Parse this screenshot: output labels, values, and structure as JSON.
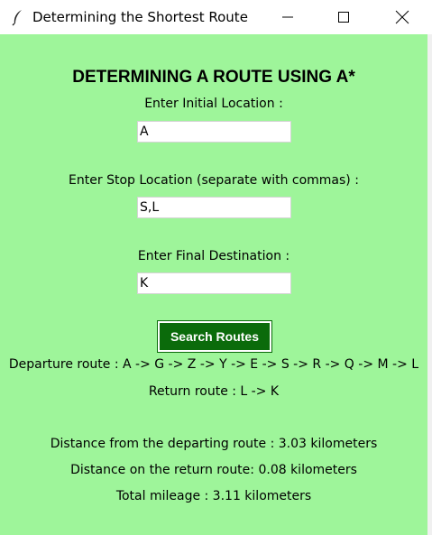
{
  "window": {
    "title": "Determining the Shortest Route",
    "icon": "feather-icon",
    "controls": [
      "minimize-icon",
      "maximize-icon",
      "close-icon"
    ]
  },
  "form": {
    "heading": "DETERMINING A ROUTE USING A*",
    "initial_label": "Enter Initial Location :",
    "initial_value": "A",
    "stop_label": "Enter Stop Location (separate with commas) :",
    "stop_value": "S,L",
    "final_label": "Enter Final Destination :",
    "final_value": "K",
    "search_button": "Search Routes"
  },
  "results": {
    "departure_route": "Departure route : A -> G -> Z -> Y -> E -> S -> R -> Q -> M -> L",
    "return_route": "Return route : L -> K",
    "departure_distance": "Distance from the departing route : 3.03 kilometers",
    "return_distance": "Distance on the return route: 0.08 kilometers",
    "total_mileage": "Total mileage : 3.11 kilometers"
  },
  "colors": {
    "background": "#9ef59a",
    "button": "#0b6b0b",
    "button_text": "#ffffff"
  }
}
